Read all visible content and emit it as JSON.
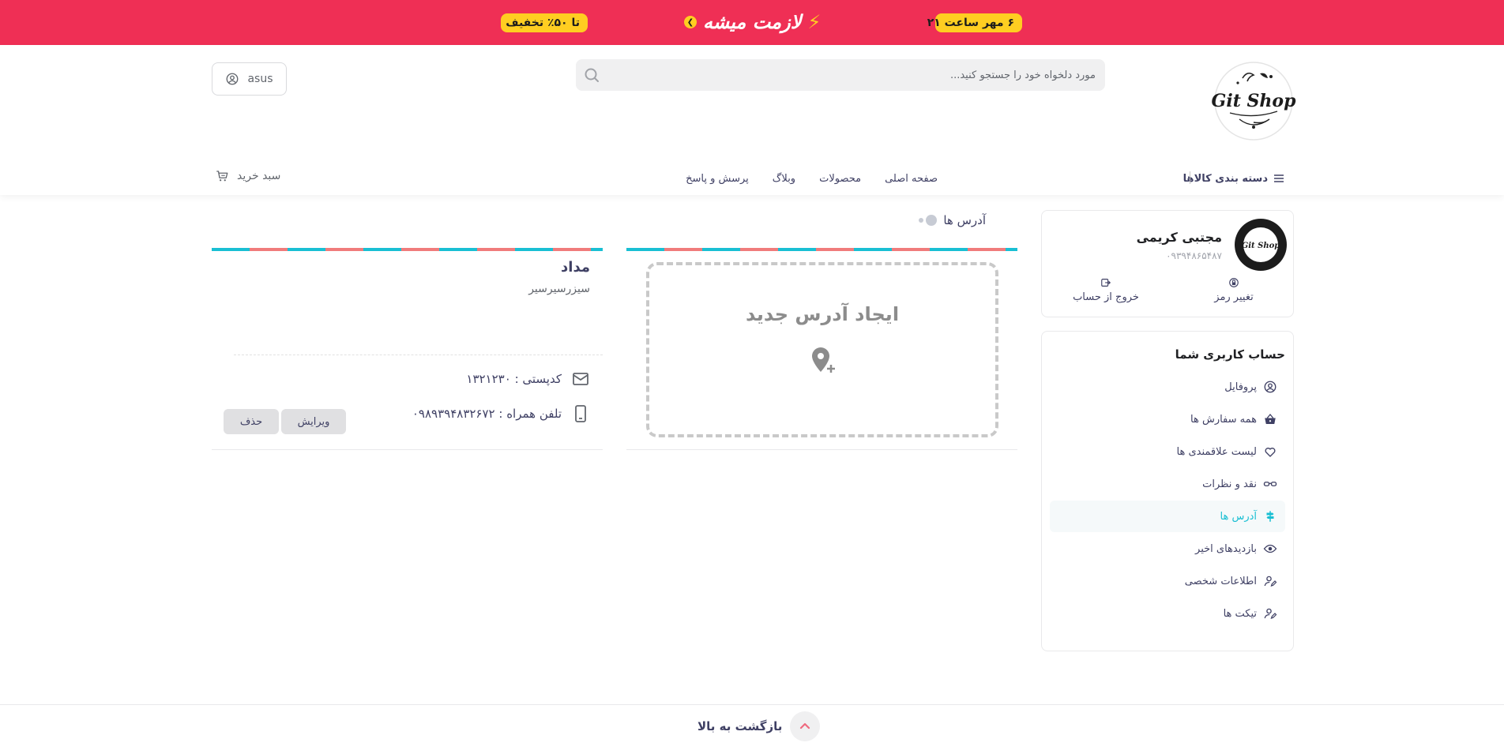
{
  "promo": {
    "date_text": "۶ مهر ساعت ۲۱",
    "brand_text": "لازمت میشه",
    "discount_text": "تا ۵۰٪ تخفیف",
    "bg_color": "#ef2f55",
    "pill_color": "#ffce21"
  },
  "header": {
    "logo_text": "Git Shop",
    "search_placeholder": "مورد دلخواه خود را جستجو کنید...",
    "user_label": "asus",
    "cart_label": "سبد خرید",
    "nav": {
      "categories": "دسته بندی کالاها",
      "links": [
        "صفحه اصلی",
        "محصولات",
        "وبلاگ",
        "پرسش و پاسخ"
      ]
    }
  },
  "profile": {
    "name": "مجتبی کریمی",
    "phone": "۰۹۳۹۴۸۶۵۴۸۷",
    "avatar_text": "Git Shop",
    "change_password": "تغییر رمز",
    "logout": "خروج از حساب"
  },
  "account_menu": {
    "title": "حساب کاربری شما",
    "items": [
      {
        "label": "پروفایل",
        "icon": "user-circle-icon"
      },
      {
        "label": "همه سفارش ها",
        "icon": "basket-icon"
      },
      {
        "label": "لیست علاقمندی ها",
        "icon": "heart-icon"
      },
      {
        "label": "نقد و نظرات",
        "icon": "glasses-icon"
      },
      {
        "label": "آدرس ها",
        "icon": "signpost-icon",
        "active": true
      },
      {
        "label": "بازدیدهای اخیر",
        "icon": "eye-icon"
      },
      {
        "label": "اطلاعات شخصی",
        "icon": "user-edit-icon"
      },
      {
        "label": "تیکت ها",
        "icon": "user-edit-icon"
      }
    ],
    "active_color": "#19bfd3"
  },
  "main": {
    "section_title": "آدرس ها",
    "new_address_label": "ایجاد آدرس جدید",
    "address": {
      "title": "مداد",
      "detail": "سیزرسیرسیر",
      "postal_label": "کدپستی : ۱۳۲۱۲۳۰",
      "phone_label": "تلفن همراه : ۰۹۸۹۳۹۴۸۳۲۶۷۲",
      "edit_button": "ویرایش",
      "delete_button": "حذف"
    }
  },
  "footer": {
    "back_to_top": "بازگشت به بالا"
  }
}
